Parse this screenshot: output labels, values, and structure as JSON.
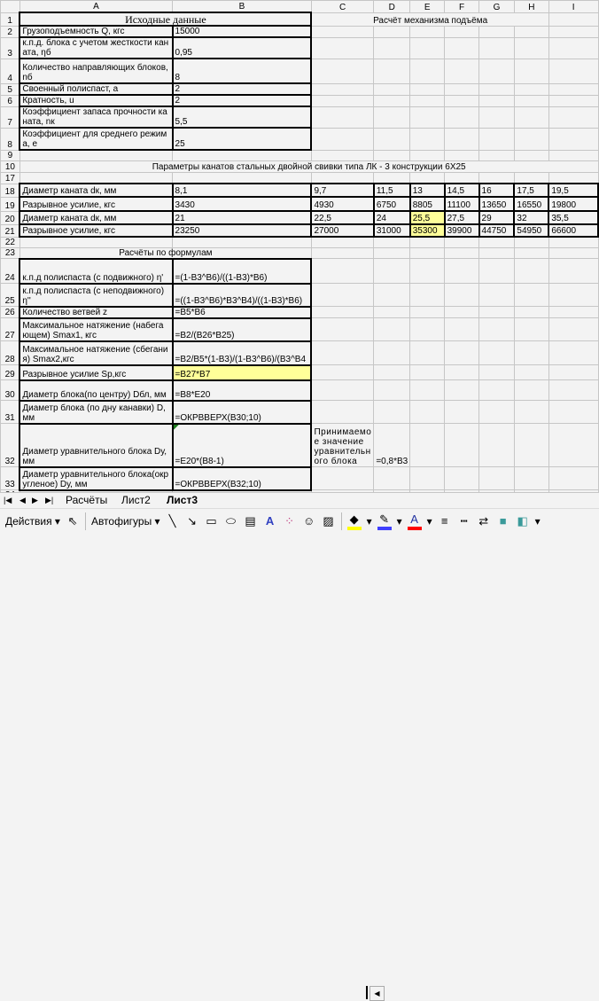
{
  "columns": [
    "",
    "A",
    "B",
    "C",
    "D",
    "E",
    "F",
    "G",
    "H",
    "I"
  ],
  "rows": [
    {
      "n": "1",
      "cells": {
        "A": "Исходные данные",
        "C": "Расчёт механизма подъёма"
      }
    },
    {
      "n": "2",
      "cells": {
        "A": "Грузоподъемность Q, кгс",
        "B": "15000"
      }
    },
    {
      "n": "3",
      "cells": {
        "A": "к.п.д. блока с учетом жесткости каната, ηб",
        "B": "0,95"
      }
    },
    {
      "n": "4",
      "cells": {
        "A": "Количество направляющих блоков, nб",
        "B": "8"
      }
    },
    {
      "n": "5",
      "cells": {
        "A": "Своенный полиспаст, a",
        "B": "2"
      }
    },
    {
      "n": "6",
      "cells": {
        "A": "Кратность, u",
        "B": "2"
      }
    },
    {
      "n": "7",
      "cells": {
        "A": "Коэффициент запаса прочности каната, nк",
        "B": "5,5"
      }
    },
    {
      "n": "8",
      "cells": {
        "A": "Коэффициент для среднего режима, e",
        "B": "25"
      }
    },
    {
      "n": "9",
      "cells": {}
    },
    {
      "n": "10",
      "cells": {
        "A": "Параметры канатов стальных двойной свивки типа ЛК - 3 конструкции 6Х25"
      }
    },
    {
      "n": "17",
      "cells": {}
    },
    {
      "n": "18",
      "cells": {
        "A": "Диаметр каната dк, мм",
        "B": "8,1",
        "C": "9,7",
        "D": "11,5",
        "E": "13",
        "F": "14,5",
        "G": "16",
        "H": "17,5",
        "I": "19,5"
      }
    },
    {
      "n": "19",
      "cells": {
        "A": "Разрывное усилие, кгс",
        "B": "3430",
        "C": "4930",
        "D": "6750",
        "E": "8805",
        "F": "11100",
        "G": "13650",
        "H": "16550",
        "I": "19800"
      }
    },
    {
      "n": "20",
      "cells": {
        "A": "Диаметр каната dк, мм",
        "B": "21",
        "C": "22,5",
        "D": "24",
        "E": "25,5",
        "F": "27,5",
        "G": "29",
        "H": "32",
        "I": "35,5"
      }
    },
    {
      "n": "21",
      "cells": {
        "A": "Разрывное усилие, кгс",
        "B": "23250",
        "C": "27000",
        "D": "31000",
        "E": "35300",
        "F": "39900",
        "G": "44750",
        "H": "54950",
        "I": "66600"
      }
    },
    {
      "n": "22",
      "cells": {}
    },
    {
      "n": "23",
      "cells": {
        "A": "Расчёты по формулам"
      }
    },
    {
      "n": "24",
      "cells": {
        "A": "к.п.д полиспаста (с подвижного) η'",
        "B": "=(1-B3^B6)/((1-B3)*B6)"
      }
    },
    {
      "n": "25",
      "cells": {
        "A": "к.п.д полиспаста (с неподвижного) η''",
        "B": "=((1-B3^B6)*B3^B4)/((1-B3)*B6)"
      }
    },
    {
      "n": "26",
      "cells": {
        "A": "Количество ветвей z",
        "B": "=B5*B6"
      }
    },
    {
      "n": "27",
      "cells": {
        "A": "Максимальное натяжение (набегающем) Smax1, кгс",
        "B": "=B2/(B26*B25)"
      }
    },
    {
      "n": "28",
      "cells": {
        "A": "Максимальное натяжение (сбегания) Smax2,кгс",
        "B": "=B2/B5*(1-B3)/(1-B3^B6)/(B3^B4"
      }
    },
    {
      "n": "29",
      "cells": {
        "A": "Разрывное усилие Sp,кгс",
        "B": "=B27*B7"
      }
    },
    {
      "n": "30",
      "cells": {
        "A": "Диаметр блока(по центру) Dбл, мм",
        "B": "=B8*E20"
      }
    },
    {
      "n": "31",
      "cells": {
        "A": "Диаметр блока (по дну канавки) D, мм",
        "B": "=ОКРВВЕРХ(B30;10)"
      }
    },
    {
      "n": "32",
      "cells": {
        "A": "Диаметр уравнительного блока Dу, мм",
        "B": "=E20*(B8-1)",
        "C": "Принимаемое значение уравнительного блока",
        "D": "=0,8*B3"
      }
    },
    {
      "n": "33",
      "cells": {
        "A": "Диаметр уравнительного блока(округленое) Dу, мм",
        "B": "=ОКРВВЕРХ(B32;10)"
      }
    },
    {
      "n": "34",
      "cells": {}
    }
  ],
  "highlight_color": "#ffff99",
  "sheet_tabs": [
    {
      "label": "Расчёты",
      "active": false
    },
    {
      "label": "Лист2",
      "active": false
    },
    {
      "label": "Лист3",
      "active": true
    }
  ],
  "toolbar": {
    "actions_label": "Действия",
    "autoshapes_label": "Автофигуры",
    "fill_color": "#ffff00",
    "line_color": "#4040ff",
    "font_color": "#ff0000"
  }
}
